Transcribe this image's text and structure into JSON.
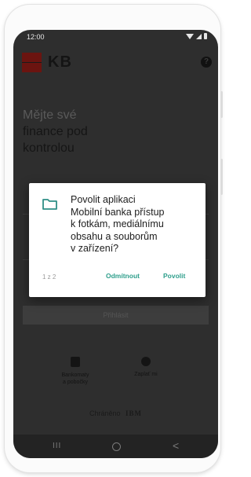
{
  "statusbar": {
    "time": "12:00"
  },
  "app": {
    "brand": "KB",
    "help_glyph": "?",
    "hero_lines": [
      "Mějte své",
      "finance pod",
      "kontrolou"
    ],
    "login_button": "Přihlásit",
    "quick_links": [
      {
        "label_1": "Bankomaty",
        "label_2": "a pobočky",
        "icon": "map-pin-icon"
      },
      {
        "label_1": "Zaplať mi",
        "label_2": "",
        "icon": "pay-me-icon"
      }
    ],
    "protected_by": "Chráněno",
    "protector": "IBM"
  },
  "dialog": {
    "message_lines": [
      "Povolit aplikaci",
      "Mobilní banka přístup",
      "k fotkám, mediálnímu",
      "obsahu a souborům",
      "v zařízení?"
    ],
    "counter": "1 z 2",
    "deny_label": "Odmítnout",
    "allow_label": "Povolit",
    "accent_color": "#2f9f8c",
    "icon": "folder-icon"
  },
  "navbar": {
    "recent": "III",
    "back": "<"
  }
}
